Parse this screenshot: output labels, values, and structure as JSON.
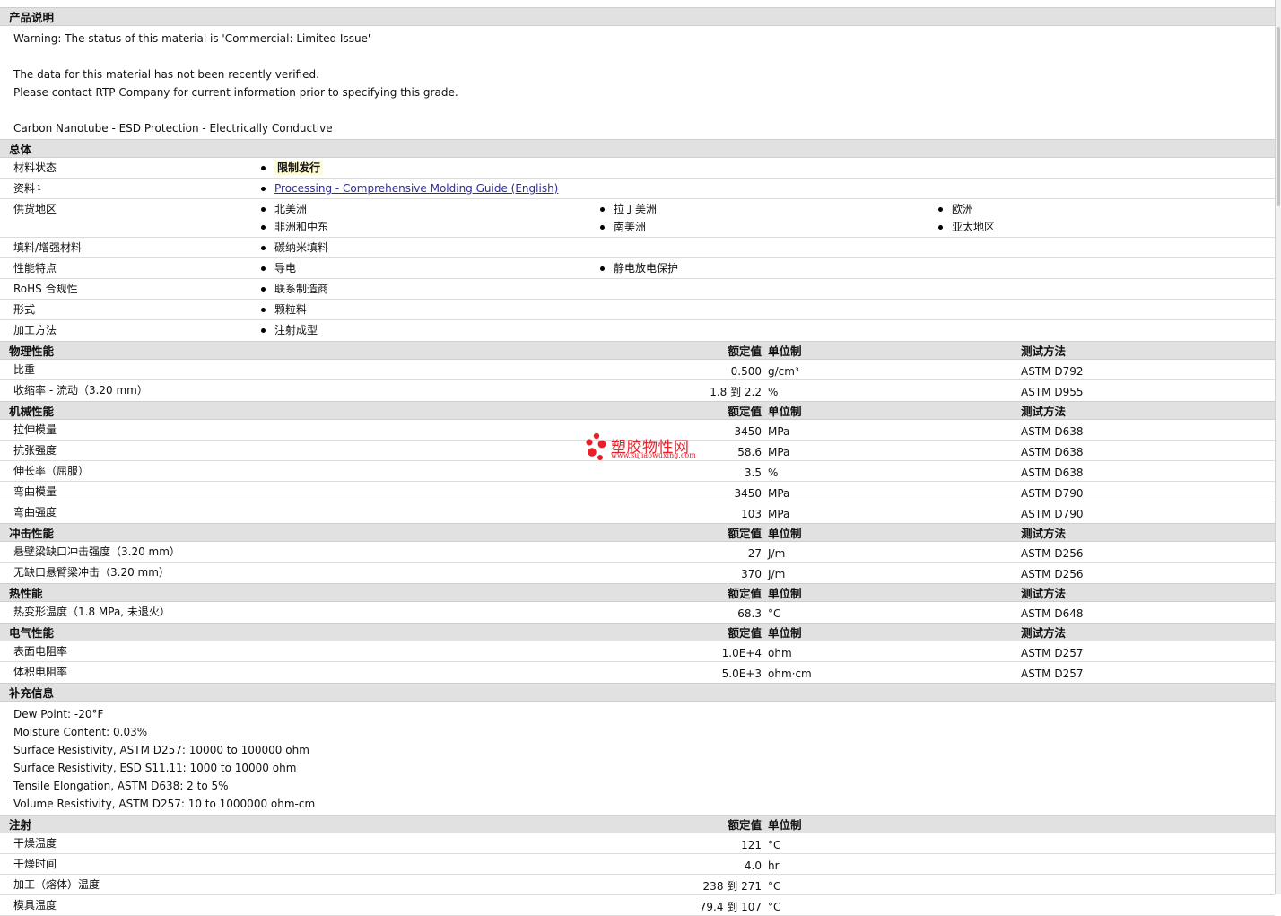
{
  "product_description": {
    "title": "产品说明",
    "lines": [
      "Warning: The status of this material is 'Commercial: Limited Issue'",
      "",
      "The data for this material has not been recently verified.",
      "Please contact RTP Company for current information prior to specifying this grade.",
      "",
      "Carbon Nanotube - ESD Protection - Electrically Conductive"
    ]
  },
  "general": {
    "title": "总体",
    "rows": [
      {
        "label": "材料状态",
        "items": [
          "限制发行"
        ]
      },
      {
        "label": "资料",
        "footnote": "1",
        "link": "Processing - Comprehensive Molding Guide (English)"
      },
      {
        "label": "供货地区",
        "items": [
          "北美洲",
          "拉丁美洲",
          "欧洲",
          "非洲和中东",
          "南美洲",
          "亚太地区"
        ]
      },
      {
        "label": "填料/增强材料",
        "items": [
          "碳纳米填料"
        ]
      },
      {
        "label": "性能特点",
        "items": [
          "导电",
          "静电放电保护"
        ]
      },
      {
        "label": "RoHS 合规性",
        "items": [
          "联系制造商"
        ]
      },
      {
        "label": "形式",
        "items": [
          "颗粒料"
        ]
      },
      {
        "label": "加工方法",
        "items": [
          "注射成型"
        ]
      }
    ]
  },
  "headers": {
    "value": "额定值",
    "unit": "单位制",
    "test": "测试方法"
  },
  "physical": {
    "title": "物理性能",
    "rows": [
      {
        "label": "比重",
        "value": "0.500",
        "unit": "g/cm³",
        "test": "ASTM D792"
      },
      {
        "label": "收缩率 - 流动（3.20 mm）",
        "value": "1.8 到  2.2",
        "unit": "%",
        "test": "ASTM D955"
      }
    ]
  },
  "mechanical": {
    "title": "机械性能",
    "rows": [
      {
        "label": "拉伸模量",
        "value": "3450",
        "unit": "MPa",
        "test": "ASTM D638"
      },
      {
        "label": "抗张强度",
        "value": "58.6",
        "unit": "MPa",
        "test": "ASTM D638"
      },
      {
        "label": "伸长率（屈服）",
        "value": "3.5",
        "unit": "%",
        "test": "ASTM D638"
      },
      {
        "label": "弯曲模量",
        "value": "3450",
        "unit": "MPa",
        "test": "ASTM D790"
      },
      {
        "label": "弯曲强度",
        "value": "103",
        "unit": "MPa",
        "test": "ASTM D790"
      }
    ]
  },
  "impact": {
    "title": "冲击性能",
    "rows": [
      {
        "label": "悬壁梁缺口冲击强度（3.20 mm）",
        "value": "27",
        "unit": "J/m",
        "test": "ASTM D256"
      },
      {
        "label": "无缺口悬臂梁冲击（3.20 mm）",
        "value": "370",
        "unit": "J/m",
        "test": "ASTM D256"
      }
    ]
  },
  "thermal": {
    "title": "热性能",
    "rows": [
      {
        "label": "热变形温度（1.8 MPa, 未退火）",
        "value": "68.3",
        "unit": "°C",
        "test": "ASTM D648"
      }
    ]
  },
  "electrical": {
    "title": "电气性能",
    "rows": [
      {
        "label": "表面电阻率",
        "value": "1.0E+4",
        "unit": "ohm",
        "test": "ASTM D257"
      },
      {
        "label": "体积电阻率",
        "value": "5.0E+3",
        "unit": "ohm·cm",
        "test": "ASTM D257"
      }
    ]
  },
  "supplement": {
    "title": "补充信息",
    "lines": [
      "Dew Point: -20°F",
      "Moisture Content: 0.03%",
      "Surface Resistivity, ASTM D257: 10000 to 100000 ohm",
      "Surface Resistivity, ESD S11.11: 1000 to 10000 ohm",
      "Tensile Elongation, ASTM D638: 2 to 5%",
      "Volume Resistivity, ASTM D257: 10 to 1000000 ohm-cm"
    ]
  },
  "injection": {
    "title": "注射",
    "rows": [
      {
        "label": "干燥温度",
        "value": "121",
        "unit": "°C"
      },
      {
        "label": "干燥时间",
        "value": "4.0",
        "unit": "hr"
      },
      {
        "label": "加工（熔体）温度",
        "value": "238 到  271",
        "unit": "°C"
      },
      {
        "label": "模具温度",
        "value": "79.4 到  107",
        "unit": "°C"
      }
    ]
  },
  "watermark": {
    "title": "塑胶物性网",
    "url": "www.sujiaowuxing.com",
    "color": "#e8202a"
  }
}
